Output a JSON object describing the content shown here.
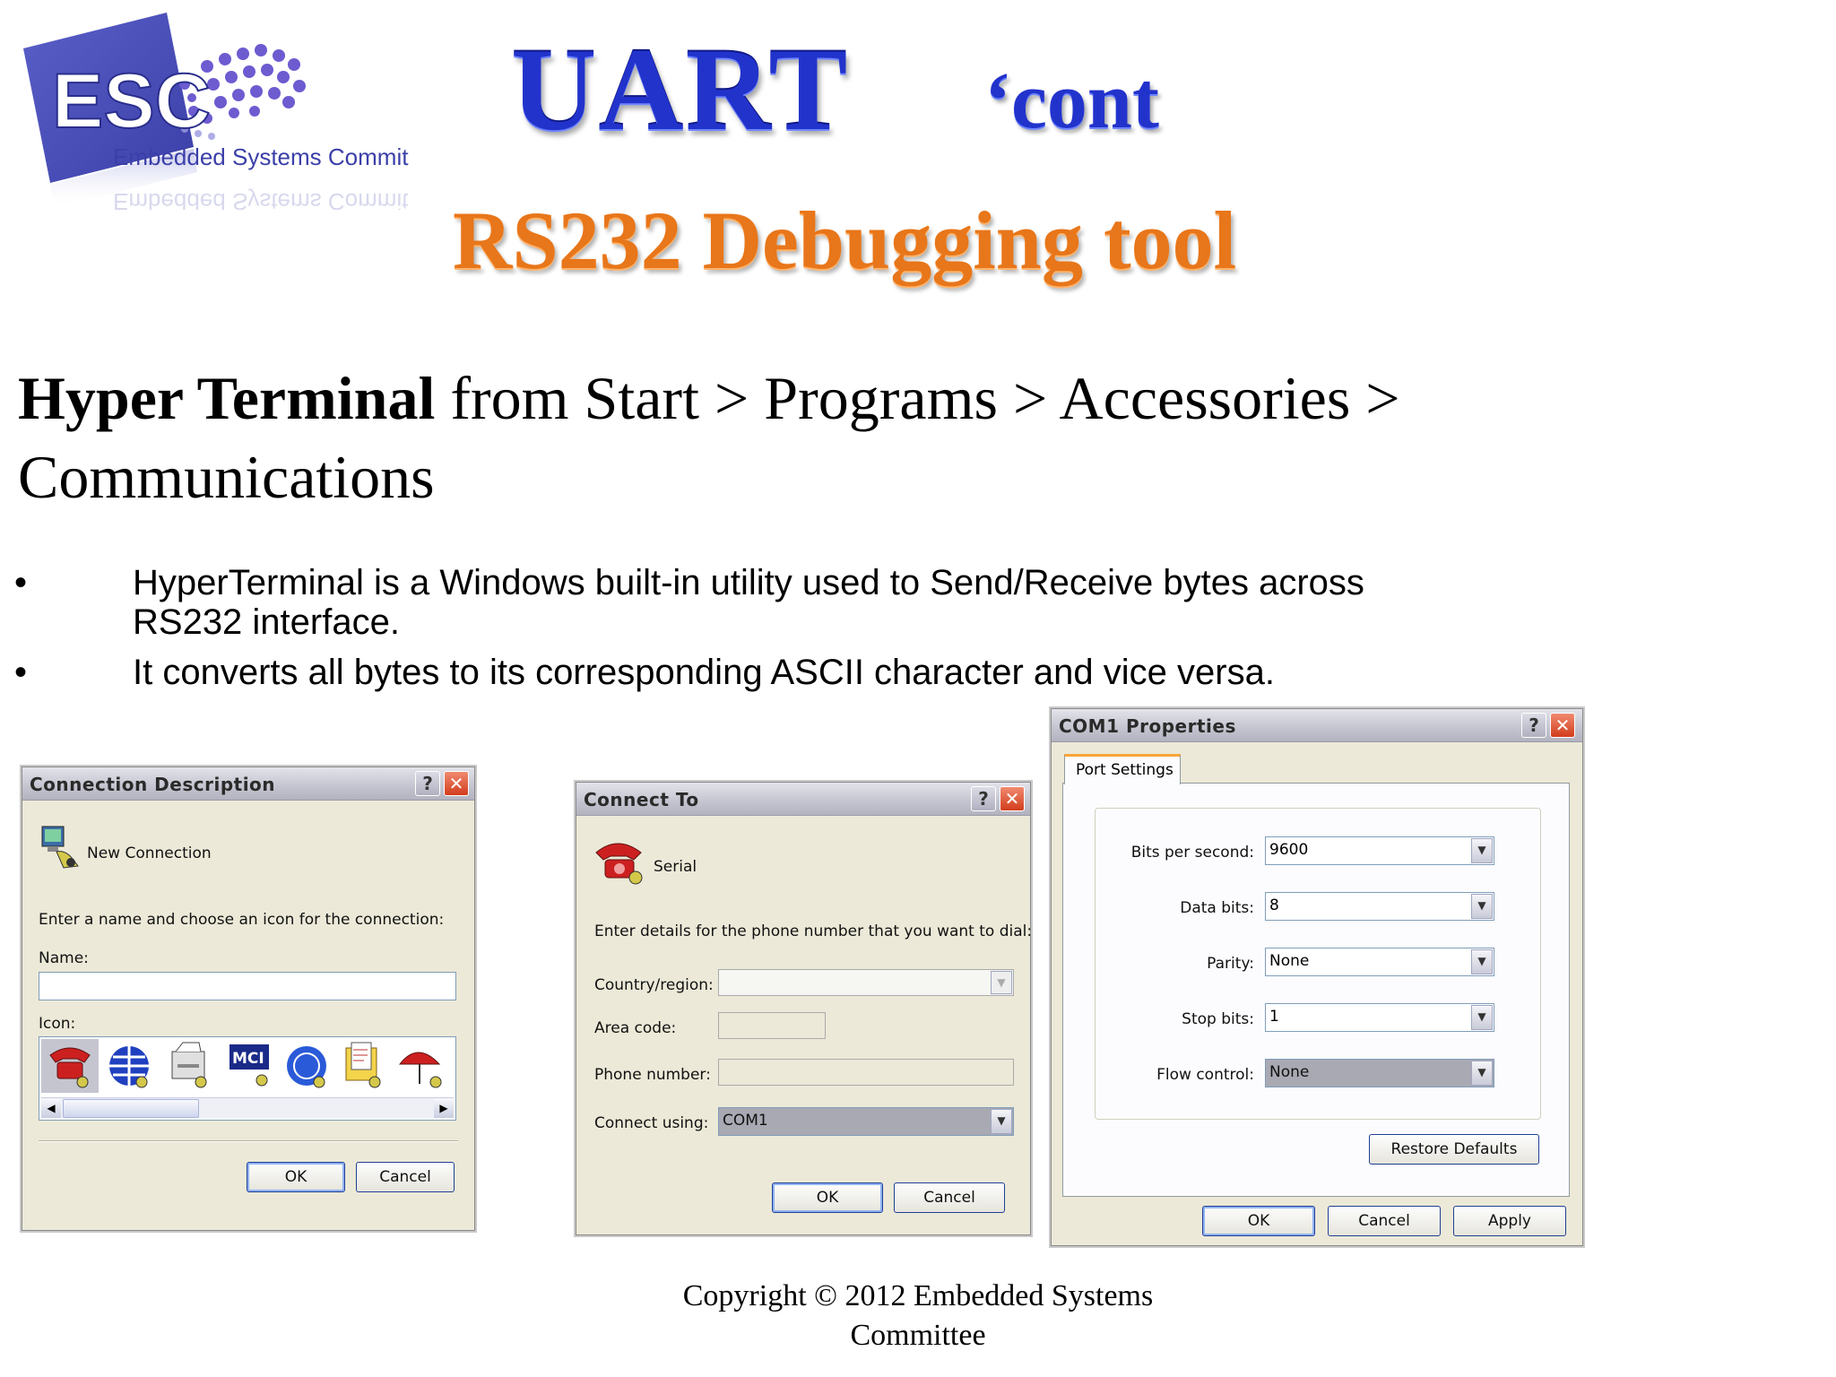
{
  "logo": {
    "text": "ESC",
    "caption": "Embedded Systems Committee"
  },
  "title": {
    "main": "UART",
    "suffix": "‘cont",
    "subtitle": "RS232 Debugging tool"
  },
  "heading": {
    "bold": "Hyper Terminal",
    "rest": "from Start > Programs > Accessories > Communications"
  },
  "bullets": [
    {
      "mark": "•",
      "text": "HyperTerminal is a Windows built-in utility used to Send/Receive bytes across RS232 interface."
    },
    {
      "mark": "•",
      "text": "It converts all bytes to its corresponding ASCII character and vice versa."
    }
  ],
  "dialog_connection": {
    "title": "Connection Description",
    "help": "?",
    "close": "✕",
    "connection_label": "New Connection",
    "instruction": "Enter a name and choose an icon for the connection:",
    "name_label": "Name:",
    "name_value": "",
    "icon_label": "Icon:",
    "icons": [
      "phone-red-icon",
      "globe-icon",
      "fax-icon",
      "mci-icon",
      "ge-globe-icon",
      "folder-icon",
      "umbrella-icon"
    ],
    "mci_text": "MCI",
    "ok": "OK",
    "cancel": "Cancel"
  },
  "dialog_connect": {
    "title": "Connect To",
    "help": "?",
    "close": "✕",
    "connection_label": "Serial",
    "instruction": "Enter details for the phone number that you want to dial:",
    "country_label": "Country/region:",
    "area_label": "Area code:",
    "phone_label": "Phone number:",
    "connect_label": "Connect using:",
    "connect_value": "COM1",
    "ok": "OK",
    "cancel": "Cancel"
  },
  "dialog_com": {
    "title": "COM1 Properties",
    "help": "?",
    "close": "✕",
    "tab": "Port Settings",
    "fields": [
      {
        "label": "Bits per second:",
        "value": "9600"
      },
      {
        "label": "Data bits:",
        "value": "8"
      },
      {
        "label": "Parity:",
        "value": "None"
      },
      {
        "label": "Stop bits:",
        "value": "1"
      },
      {
        "label": "Flow control:",
        "value": "None"
      }
    ],
    "restore": "Restore Defaults",
    "ok": "OK",
    "cancel": "Cancel",
    "apply": "Apply"
  },
  "footer": {
    "line1": "Copyright © 2012 Embedded Systems",
    "line2": "Committee"
  },
  "colors": {
    "title_blue": "#2233cc",
    "subtitle_orange": "#e8761a",
    "dialog_bg": "#ece9d8",
    "close_red": "#d23c1c"
  }
}
